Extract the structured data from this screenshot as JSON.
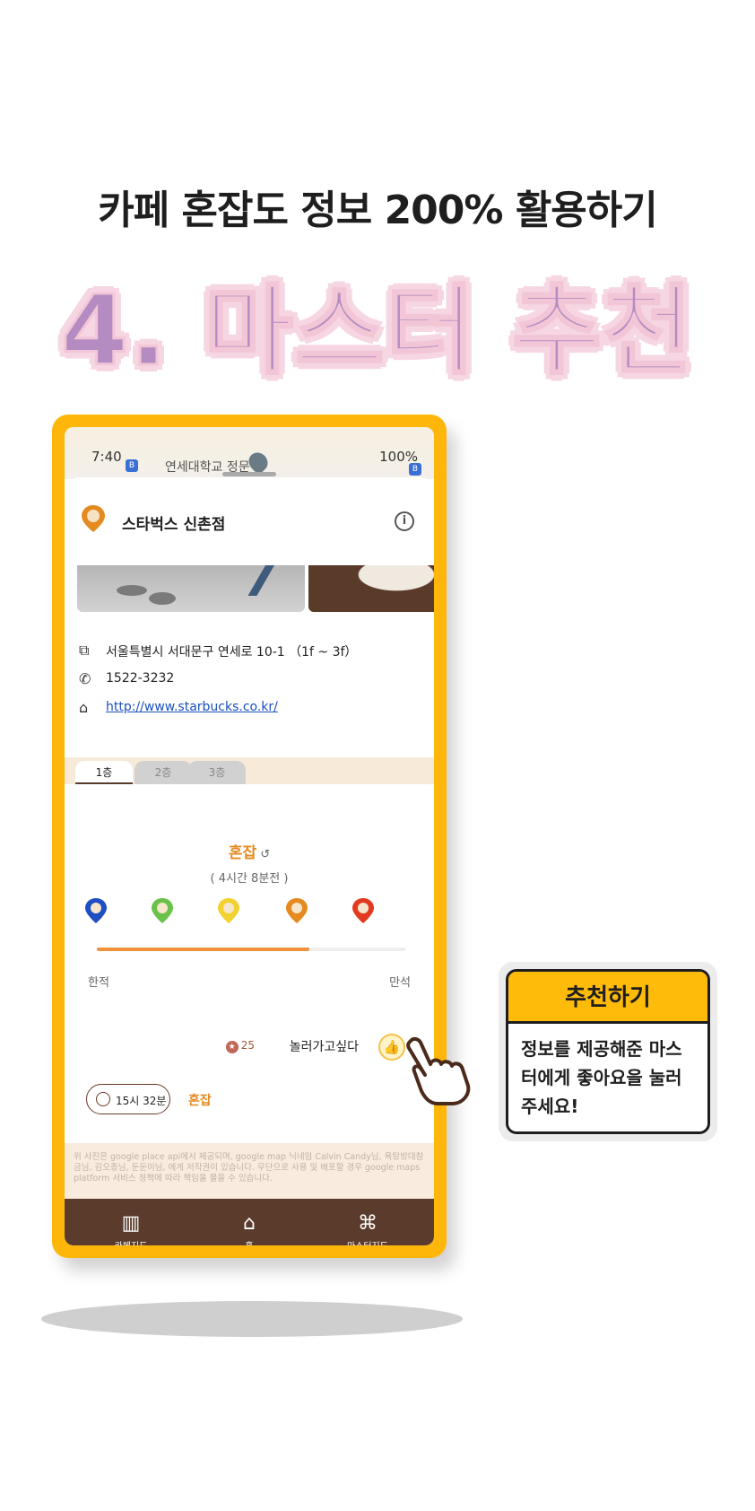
{
  "headline": "카페 혼잡도 정보 200% 활용하기",
  "big_title": "4. 마스터 추천",
  "status": {
    "time": "7:40",
    "battery": "100%",
    "map_label": "연세대학교 정문"
  },
  "store": {
    "name": "스타벅스 신촌점",
    "info_icon": "info-icon"
  },
  "info": {
    "address": "서울특별시 서대문구 연세로 10-1 （1f ~ 3f）",
    "phone": "1522-3232",
    "website": "http://www.starbucks.co.kr/"
  },
  "floors": [
    "1층",
    "2층",
    "3층"
  ],
  "crowd": {
    "status": "혼잡",
    "elapsed": "( 4시간 8분전 )",
    "level_fraction": 0.69,
    "left_label": "한적",
    "right_label": "만석",
    "level_colors": [
      "#1f4fc2",
      "#6bc24a",
      "#f2d22e",
      "#e58a1f",
      "#e23a1f"
    ]
  },
  "like": {
    "count": "25",
    "label": "놀러가고싶다"
  },
  "time": {
    "value": "15시 32분",
    "status": "혼잡"
  },
  "footer_note": "위 사진은 google place api에서 제공되며, google map 닉네임 Calvin Candy님, 욕탕방대참금님, 김오종님, 둔둔이님, 에게 저작권이 있습니다. 무단으로 사용 및 배포할 경우 google maps platform 서비스 정책에 따라 책임을 물을 수 있습니다.",
  "nav": [
    {
      "label": "카페지도",
      "icon": "map-icon"
    },
    {
      "label": "홈",
      "icon": "home-icon"
    },
    {
      "label": "마스터지도",
      "icon": "store-icon"
    }
  ],
  "callout": {
    "title": "추천하기",
    "body": "정보를 제공해준 마스터에게 좋아요을 눌러주세요!"
  },
  "colors": {
    "frame": "#ffb60a",
    "accent": "#e58a1f",
    "nav_bg": "#5a3b2c",
    "title_purple": "#b48cc2"
  }
}
